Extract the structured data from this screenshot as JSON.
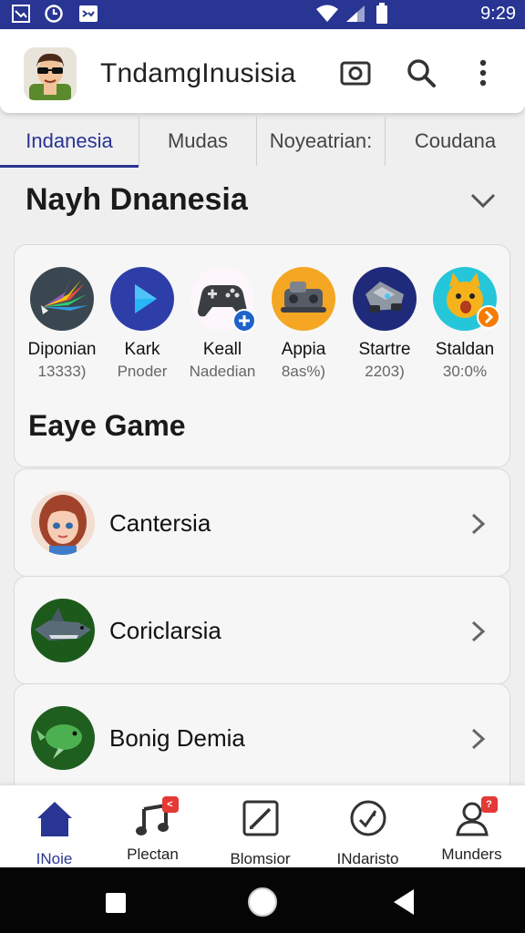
{
  "status_bar": {
    "time": "9:29",
    "left_icons": [
      "screenshot-icon",
      "clock-icon",
      "usb-icon"
    ],
    "right_icons": [
      "wifi-icon",
      "signal-icon",
      "battery-icon"
    ],
    "background": "#283593"
  },
  "app_bar": {
    "title": "TndamgInusisia",
    "actions": [
      "camera-icon",
      "search-icon",
      "more-vert-icon"
    ]
  },
  "tabs": [
    {
      "label": "Indanesia",
      "active": true
    },
    {
      "label": "Mudas",
      "active": false
    },
    {
      "label": "Noyeatrian:",
      "active": false
    },
    {
      "label": "Coudana",
      "active": false
    }
  ],
  "section": {
    "title": "Nayh Dnanesia"
  },
  "games_card": {
    "games": [
      {
        "name": "Diponian",
        "sub": "13333)",
        "icon": "arrows-burst-icon",
        "color": "#3a4750"
      },
      {
        "name": "Kark",
        "sub": "Pnoder",
        "icon": "play-icon",
        "color": "#2e3ea8"
      },
      {
        "name": "Keall",
        "sub": "Nadedian",
        "icon": "gamepad-icon",
        "color": "#ffffff"
      },
      {
        "name": "Appia",
        "sub": "8as%)",
        "icon": "console-icon",
        "color": "#f5a623"
      },
      {
        "name": "Startre",
        "sub": "2203)",
        "icon": "robot-car-icon",
        "color": "#1f2a7a"
      },
      {
        "name": "Staldan",
        "sub": "30:0%",
        "icon": "fox-mascot-icon",
        "color": "#26c6da"
      }
    ],
    "subtitle": "Eaye Game"
  },
  "list": [
    {
      "label": "Cantersia",
      "avatar": "girl-avatar-icon"
    },
    {
      "label": "Coriclarsia",
      "avatar": "shark-avatar-icon"
    },
    {
      "label": "Bonig Demia",
      "avatar": "bird-avatar-icon"
    }
  ],
  "bottom_nav": [
    {
      "label": "INoie",
      "icon": "home-icon",
      "active": true
    },
    {
      "label": "Plectan",
      "icon": "music-note-icon",
      "badge": "<"
    },
    {
      "label": "Blomsior",
      "icon": "edit-square-icon"
    },
    {
      "label": "INdaristo",
      "icon": "smiley-check-icon"
    },
    {
      "label": "Munders",
      "icon": "person-icon",
      "badge": "?"
    }
  ],
  "accent_color": "#283593"
}
